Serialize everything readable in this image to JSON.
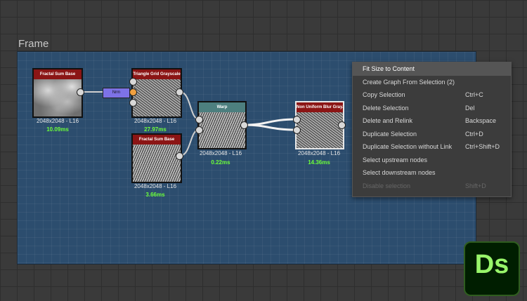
{
  "frame": {
    "title": "Frame"
  },
  "nodes": [
    {
      "id": "fractal1",
      "header": "Fractal Sum Base",
      "res": "2048x2048 - L16",
      "time": "10.09ms",
      "header_color": "#8b1515"
    },
    {
      "id": "triangle",
      "header": "Triangle Grid Grayscale",
      "res": "2048x2048 - L16",
      "time": "27.97ms",
      "header_color": "#8b1515"
    },
    {
      "id": "fractal2",
      "header": "Fractal Sum Base",
      "res": "2048x2048 - L16",
      "time": "3.66ms",
      "header_color": "#8b1515"
    },
    {
      "id": "warp",
      "header": "Warp",
      "res": "2048x2048 - L16",
      "time": "0.22ms",
      "header_color": "#4d7f7f"
    },
    {
      "id": "blur",
      "header": "Non Uniform Blur Gray...",
      "res": "2048x2048 - L16",
      "time": "14.36ms",
      "header_color": "#8b1515"
    }
  ],
  "nrm_label": "Nrm",
  "context_menu": {
    "items": [
      {
        "label": "Fit Size to Content",
        "shortcut": "",
        "state": "highlighted"
      },
      {
        "label": "Create Graph From Selection (2)",
        "shortcut": "",
        "state": "normal"
      },
      {
        "label": "Copy Selection",
        "shortcut": "Ctrl+C",
        "state": "normal"
      },
      {
        "label": "Delete Selection",
        "shortcut": "Del",
        "state": "normal"
      },
      {
        "label": "Delete and Relink",
        "shortcut": "Backspace",
        "state": "normal"
      },
      {
        "label": "Duplicate Selection",
        "shortcut": "Ctrl+D",
        "state": "normal"
      },
      {
        "label": "Duplicate Selection without Link",
        "shortcut": "Ctrl+Shift+D",
        "state": "normal"
      },
      {
        "label": "Select upstream nodes",
        "shortcut": "",
        "state": "normal"
      },
      {
        "label": "Select downstream nodes",
        "shortcut": "",
        "state": "normal"
      },
      {
        "label": "Disable selection",
        "shortcut": "Shift+D",
        "state": "disabled"
      }
    ]
  },
  "logo": {
    "text": "Ds"
  }
}
